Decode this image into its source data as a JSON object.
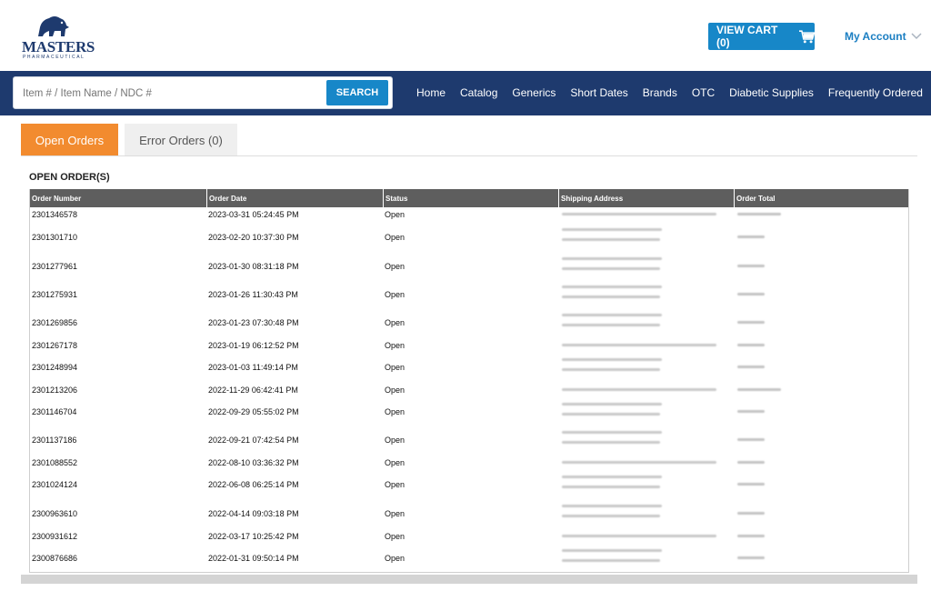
{
  "brand": {
    "name": "MASTERS",
    "tagline": "PHARMACEUTICAL"
  },
  "header": {
    "cart_label": "VIEW CART (0)",
    "account_label": "My Account"
  },
  "search": {
    "placeholder": "Item # / Item Name / NDC #",
    "button_label": "SEARCH"
  },
  "nav": [
    "Home",
    "Catalog",
    "Generics",
    "Short Dates",
    "Brands",
    "OTC",
    "Diabetic Supplies",
    "Frequently Ordered"
  ],
  "tabs": {
    "open": "Open Orders",
    "error": "Error Orders (0)"
  },
  "section_title": "OPEN ORDER(S)",
  "table": {
    "columns": [
      "Order Number",
      "Order Date",
      "Status",
      "Shipping Address",
      "Order Total"
    ],
    "rows": [
      {
        "order_number": "2301346578",
        "order_date": "2023-03-31 05:24:45 PM",
        "status": "Open"
      },
      {
        "order_number": "2301301710",
        "order_date": "2023-02-20 10:37:30 PM",
        "status": "Open"
      },
      {
        "order_number": "2301277961",
        "order_date": "2023-01-30 08:31:18 PM",
        "status": "Open"
      },
      {
        "order_number": "2301275931",
        "order_date": "2023-01-26 11:30:43 PM",
        "status": "Open"
      },
      {
        "order_number": "2301269856",
        "order_date": "2023-01-23 07:30:48 PM",
        "status": "Open"
      },
      {
        "order_number": "2301267178",
        "order_date": "2023-01-19 06:12:52 PM",
        "status": "Open"
      },
      {
        "order_number": "2301248994",
        "order_date": "2023-01-03 11:49:14 PM",
        "status": "Open"
      },
      {
        "order_number": "2301213206",
        "order_date": "2022-11-29 06:42:41 PM",
        "status": "Open"
      },
      {
        "order_number": "2301146704",
        "order_date": "2022-09-29 05:55:02 PM",
        "status": "Open"
      },
      {
        "order_number": "2301137186",
        "order_date": "2022-09-21 07:42:54 PM",
        "status": "Open"
      },
      {
        "order_number": "2301088552",
        "order_date": "2022-08-10 03:36:32 PM",
        "status": "Open"
      },
      {
        "order_number": "2301024124",
        "order_date": "2022-06-08 06:25:14 PM",
        "status": "Open"
      },
      {
        "order_number": "2300963610",
        "order_date": "2022-04-14 09:03:18 PM",
        "status": "Open"
      },
      {
        "order_number": "2300931612",
        "order_date": "2022-03-17 10:25:42 PM",
        "status": "Open"
      },
      {
        "order_number": "2300876686",
        "order_date": "2022-01-31 09:50:14 PM",
        "status": "Open"
      }
    ]
  },
  "colors": {
    "navy": "#1e3a6e",
    "accent_blue": "#1787c8",
    "tab_orange": "#f28b2f",
    "table_header": "#5e5e5e"
  },
  "icons": {
    "cart": "cart-icon",
    "account_chevron": "chevron-down-icon",
    "logo": "lion-logo-icon"
  }
}
